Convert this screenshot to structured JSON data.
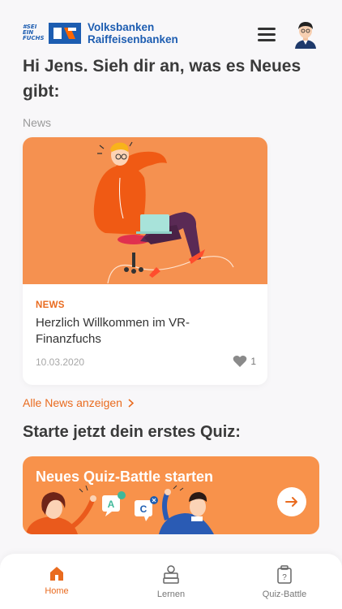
{
  "header": {
    "fuchs_logo_lines": [
      "#SEI",
      "EIN",
      "FUCHS"
    ],
    "brand_line1": "Volksbanken",
    "brand_line2": "Raiffeisenbanken",
    "menu_icon": "hamburger-menu-icon",
    "avatar_icon": "user-avatar-icon"
  },
  "greeting": "Hi Jens. Sieh dir an, was es Neues gibt:",
  "news_section_label": "News",
  "news_card": {
    "tag": "NEWS",
    "title": "Herzlich Willkommen im VR-Finanzfuchs",
    "date": "10.03.2020",
    "likes": "1",
    "like_icon": "heart-icon"
  },
  "all_news_label": "Alle News anzeigen",
  "quiz_heading": "Starte jetzt dein erstes Quiz:",
  "quiz_banner": {
    "title": "Neues Quiz-Battle starten",
    "bubble_a": "A",
    "bubble_c": "C",
    "go_icon": "arrow-right-icon"
  },
  "bottom_nav": {
    "items": [
      {
        "label": "Home",
        "icon": "home-icon",
        "active": true
      },
      {
        "label": "Lernen",
        "icon": "books-icon",
        "active": false
      },
      {
        "label": "Quiz-Battle",
        "icon": "quiz-card-icon",
        "active": false
      }
    ]
  },
  "colors": {
    "accent_orange": "#e96b1f",
    "banner_orange": "#f8924b",
    "image_orange": "#f59150",
    "brand_blue": "#1d5db1",
    "background": "#f8f7f9"
  }
}
